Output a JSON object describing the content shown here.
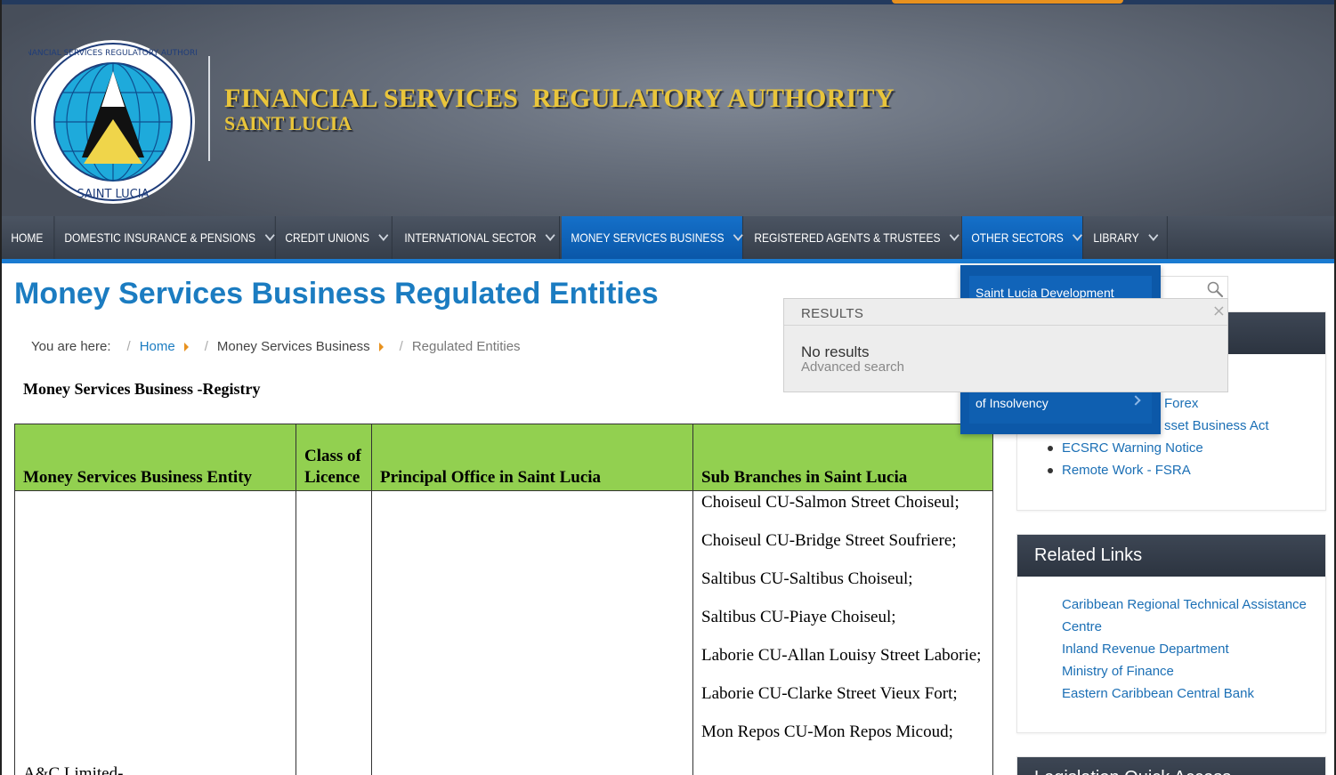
{
  "site": {
    "title": "FINANCIAL SERVICES  REGULATORY AUTHORITY",
    "subtitle": "SAINT LUCIA",
    "logo_ring_text": "FINANCIAL SERVICES REGULATORY AUTHORITY",
    "logo_bottom_text": "SAINT LUCIA"
  },
  "nav": {
    "items": [
      {
        "label": "HOME"
      },
      {
        "label": "DOMESTIC INSURANCE & PENSIONS"
      },
      {
        "label": "CREDIT UNIONS"
      },
      {
        "label": "INTERNATIONAL SECTOR"
      },
      {
        "label": "MONEY SERVICES BUSINESS"
      },
      {
        "label": "REGISTERED AGENTS & TRUSTEES"
      },
      {
        "label": "OTHER SECTORS"
      },
      {
        "label": "LIBRARY"
      }
    ],
    "dropdown": {
      "item1": "Saint Lucia Development",
      "item2": "of Insolvency"
    }
  },
  "page": {
    "title": "Money Services Business Regulated Entities"
  },
  "breadcrumb": {
    "prefix": "You are here:",
    "home": "Home",
    "section": "Money Services Business",
    "current": "Regulated Entities"
  },
  "search_results": {
    "header": "RESULTS",
    "message": "No results",
    "advanced": "Advanced search",
    "close": "⨯"
  },
  "registry": {
    "heading": "Money Services Business -Registry",
    "columns": [
      "Money Services Business Entity",
      "Class of Licence",
      "Principal Office in Saint Lucia",
      "Sub Branches in Saint Lucia"
    ],
    "rows": [
      {
        "entity": "A&C Limited-",
        "class": "",
        "principal_office": "",
        "branches": [
          "Choiseul CU-Salmon Street Choiseul;",
          "Choiseul CU-Bridge Street Soufriere;",
          "Saltibus CU-Saltibus Choiseul;",
          "Saltibus CU-Piaye Choiseul;",
          "Laborie CU-Allan Louisy Street Laborie;",
          "Laborie CU-Clarke Street Vieux Fort;",
          "Mon Repos CU-Mon Repos Micoud;"
        ]
      }
    ]
  },
  "sidebar": {
    "box1": {
      "items": [
        "Forex",
        "sset Business Act",
        "ECSRC Warning Notice",
        "Remote Work - FSRA"
      ]
    },
    "related": {
      "title": "Related Links",
      "items": [
        "Caribbean Regional Technical Assistance",
        "Centre",
        "Inland Revenue Department",
        "Ministry of Finance",
        "Eastern Caribbean Central Bank"
      ]
    },
    "legislation": {
      "title": "Legislation Quick Access"
    }
  }
}
